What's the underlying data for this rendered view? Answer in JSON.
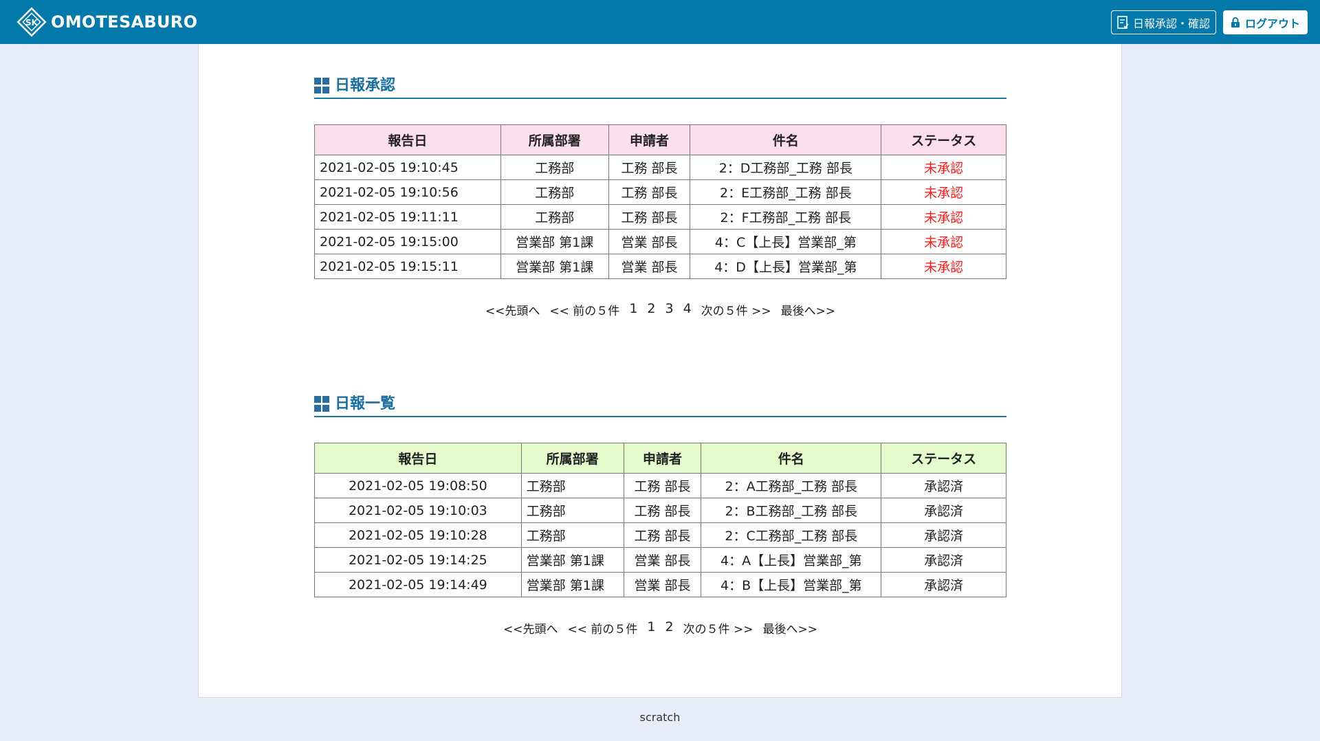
{
  "header": {
    "brand": "OMOTESABURO",
    "approve_button": "日報承認・確認",
    "logout_button": "ログアウト",
    "colors": {
      "bar": "#0279aa"
    }
  },
  "approval": {
    "title": "日報承認",
    "columns": [
      "報告日",
      "所属部署",
      "申請者",
      "件名",
      "ステータス"
    ],
    "rows": [
      [
        "2021-02-05 19:10:45",
        "工務部",
        "工務 部長",
        "2：D工務部_工務 部長",
        "未承認"
      ],
      [
        "2021-02-05 19:10:56",
        "工務部",
        "工務 部長",
        "2：E工務部_工務 部長",
        "未承認"
      ],
      [
        "2021-02-05 19:11:11",
        "工務部",
        "工務 部長",
        "2：F工務部_工務 部長",
        "未承認"
      ],
      [
        "2021-02-05 19:15:00",
        "営業部 第1課",
        "営業 部長",
        "4：C【上長】営業部_第",
        "未承認"
      ],
      [
        "2021-02-05 19:15:11",
        "営業部 第1課",
        "営業 部長",
        "4：D【上長】営業部_第",
        "未承認"
      ]
    ],
    "pager": {
      "first": "<<先頭へ",
      "prev": "<< 前の５件",
      "pages": [
        "1",
        "2",
        "3",
        "4"
      ],
      "next": "次の５件 >>",
      "last": "最後へ>>"
    }
  },
  "list": {
    "title": "日報一覧",
    "columns": [
      "報告日",
      "所属部署",
      "申請者",
      "件名",
      "ステータス"
    ],
    "rows": [
      [
        "2021-02-05 19:08:50",
        "工務部",
        "工務 部長",
        "2：A工務部_工務 部長",
        "承認済"
      ],
      [
        "2021-02-05 19:10:03",
        "工務部",
        "工務 部長",
        "2：B工務部_工務 部長",
        "承認済"
      ],
      [
        "2021-02-05 19:10:28",
        "工務部",
        "工務 部長",
        "2：C工務部_工務 部長",
        "承認済"
      ],
      [
        "2021-02-05 19:14:25",
        "営業部 第1課",
        "営業 部長",
        "4：A【上長】営業部_第",
        "承認済"
      ],
      [
        "2021-02-05 19:14:49",
        "営業部 第1課",
        "営業 部長",
        "4：B【上長】営業部_第",
        "承認済"
      ]
    ],
    "pager": {
      "first": "<<先頭へ",
      "prev": "<< 前の５件",
      "pages": [
        "1",
        "2"
      ],
      "next": "次の５件 >>",
      "last": "最後へ>>"
    }
  },
  "footer": {
    "text": "scratch"
  }
}
